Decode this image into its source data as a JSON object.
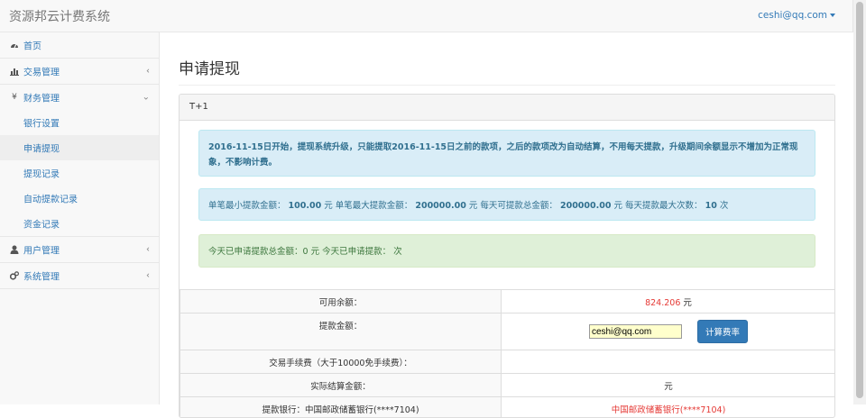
{
  "app": {
    "brand": "资源邦云计费系统",
    "user": "ceshi@qq.com"
  },
  "sidebar": {
    "items": [
      {
        "label": "首页",
        "icon": "dashboard-icon"
      },
      {
        "label": "交易管理",
        "icon": "bar-chart-icon"
      },
      {
        "label": "财务管理",
        "icon": "yen-icon"
      },
      {
        "label": "用户管理",
        "icon": "user-icon"
      },
      {
        "label": "系统管理",
        "icon": "gears-icon"
      }
    ],
    "finance_sub": [
      {
        "label": "银行设置"
      },
      {
        "label": "申请提现"
      },
      {
        "label": "提现记录"
      },
      {
        "label": "自动提款记录"
      },
      {
        "label": "资金记录"
      }
    ]
  },
  "page": {
    "title": "申请提现",
    "panel_heading": "T+1"
  },
  "alerts": {
    "notice": "2016-11-15日开始，提现系统升级，只能提取2016-11-15日之前的款项，之后的款项改为自动结算，不用每天提款，升级期间余额显示不增加为正常现象，不影响计费。",
    "limits": {
      "min_label": "单笔最小提款金额：",
      "min_value": "100.00",
      "min_unit": "元",
      "max_label": "单笔最大提款金额：",
      "max_value": "200000.00",
      "max_unit": "元",
      "daily_label": "每天可提款总金额：",
      "daily_value": "200000.00",
      "daily_unit": "元",
      "times_label": "每天提款最大次数：",
      "times_value": "10",
      "times_unit": "次"
    },
    "today": "今天已申请提款总金额：0 元  今天已申请提款： 次"
  },
  "table": {
    "balance_label": "可用余额：",
    "balance_value": "824.206",
    "balance_unit": "元",
    "amount_label": "提款金额：",
    "amount_value": "ceshi@qq.com",
    "calc_button": "计算费率",
    "fee_label": "交易手续费（大于10000免手续费）：",
    "fee_value": "",
    "actual_label": "实际结算金额：",
    "actual_value": "元",
    "bank_label": "提款银行：中国邮政储蓄银行(****7104)",
    "bank_value": "中国邮政储蓄银行(****7104)"
  }
}
